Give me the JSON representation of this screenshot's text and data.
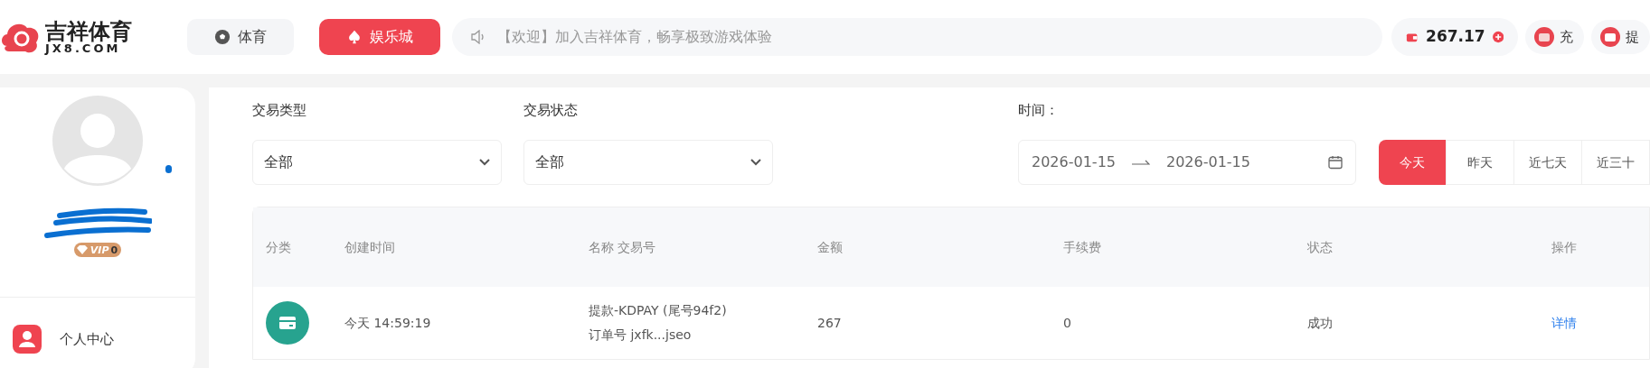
{
  "header": {
    "logo": {
      "title": "吉祥体育",
      "subtitle": "JX8.COM"
    },
    "nav": [
      {
        "label": "体育",
        "selected": false,
        "kind": "sports"
      },
      {
        "label": "娱乐城",
        "selected": true,
        "kind": "casino"
      }
    ],
    "notice": "【欢迎】加入吉祥体育，畅享极致游戏体验",
    "balance": "267.17",
    "actions": [
      {
        "label": "充",
        "kind": "deposit"
      },
      {
        "label": "提",
        "kind": "withdraw"
      }
    ]
  },
  "profile": {
    "vip_label": "VIP",
    "vip_level": "0"
  },
  "menu": [
    {
      "label": "个人中心"
    }
  ],
  "filters": {
    "type": {
      "label": "交易类型",
      "value": "全部"
    },
    "status": {
      "label": "交易状态",
      "value": "全部"
    },
    "time": {
      "label": "时间：",
      "start": "2026-01-15",
      "end": "2026-01-15"
    },
    "quick": [
      {
        "label": "今天",
        "selected": true
      },
      {
        "label": "昨天",
        "selected": false
      },
      {
        "label": "近七天",
        "selected": false
      },
      {
        "label": "近三十",
        "selected": false
      }
    ]
  },
  "table": {
    "columns": [
      "分类",
      "创建时间",
      "名称 交易号",
      "金额",
      "手续费",
      "状态",
      "操作"
    ],
    "rows": [
      {
        "time": "今天 14:59:19",
        "name": "提款-KDPAY (尾号94f2)",
        "order": "订单号 jxfk...jseo",
        "amount": "267",
        "fee": "0",
        "status": "成功",
        "action": "详情"
      }
    ]
  }
}
